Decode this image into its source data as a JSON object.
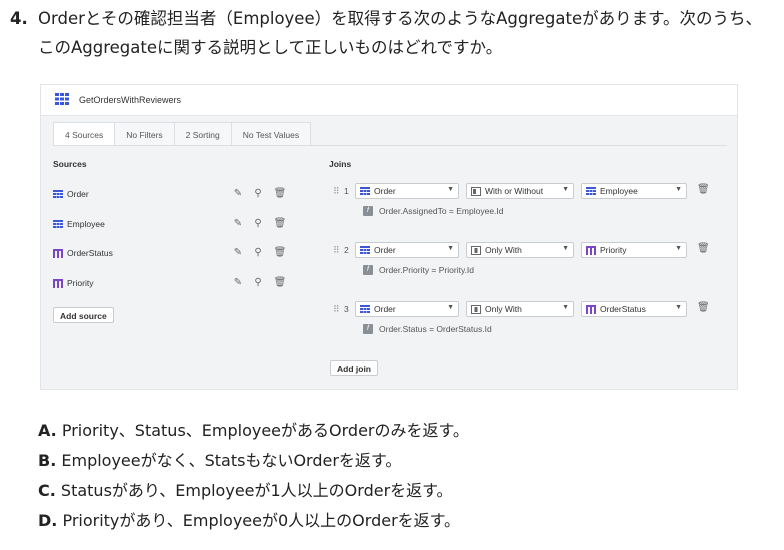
{
  "question": {
    "number": "4.",
    "text": "Orderとその確認担当者（Employee）を取得する次のようなAggregateがあります。次のうち、このAggregateに関する説明として正しいものはどれですか。"
  },
  "aggregate": {
    "title": "GetOrdersWithReviewers",
    "icon": "aggregate-grid-icon",
    "accent_color": "#3b57d8",
    "tabs": [
      "4 Sources",
      "No Filters",
      "2 Sorting",
      "No Test Values"
    ],
    "sources_title": "Sources",
    "sources": [
      {
        "name": "Order",
        "icon": "entity-icon",
        "icon_color": "#3b57d8"
      },
      {
        "name": "Employee",
        "icon": "entity-icon",
        "icon_color": "#3b57d8"
      },
      {
        "name": "OrderStatus",
        "icon": "static-entity-icon",
        "icon_color": "#7a45c9"
      },
      {
        "name": "Priority",
        "icon": "static-entity-icon",
        "icon_color": "#7a45c9"
      }
    ],
    "add_source_label": "Add source",
    "joins_title": "Joins",
    "joins": [
      {
        "index": "1",
        "left": "Order",
        "type": "With or Without",
        "right": "Employee",
        "condition": "Order.AssignedTo = Employee.Id"
      },
      {
        "index": "2",
        "left": "Order",
        "type": "Only With",
        "right": "Priority",
        "condition": "Order.Priority = Priority.Id"
      },
      {
        "index": "3",
        "left": "Order",
        "type": "Only With",
        "right": "OrderStatus",
        "condition": "Order.Status = OrderStatus.Id"
      }
    ],
    "add_join_label": "Add join"
  },
  "answers": [
    {
      "letter": "A.",
      "text": " Priority、Status、EmployeeがあるOrderのみを返す。"
    },
    {
      "letter": "B.",
      "text": " Employeeがなく、StatsもないOrderを返す。"
    },
    {
      "letter": "C.",
      "text": " Statusがあり、Employeeが1人以上のOrderを返す。"
    },
    {
      "letter": "D.",
      "text": " Priorityがあり、Employeeが0人以上のOrderを返す。"
    }
  ]
}
